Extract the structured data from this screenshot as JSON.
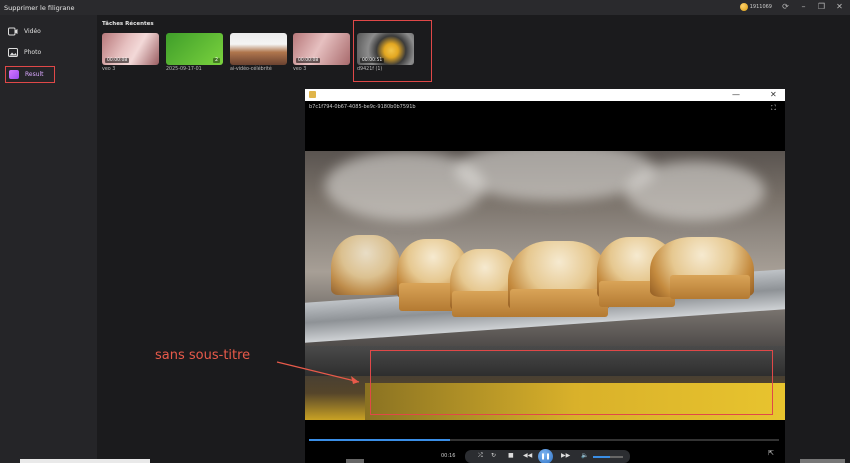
{
  "app": {
    "title": "Supprimer le filigrane"
  },
  "titlebar": {
    "user_id": "1911069",
    "icons": [
      "coin-icon",
      "refresh-icon",
      "minimize-icon",
      "restore-icon",
      "close-icon"
    ]
  },
  "sidebar": {
    "items": [
      {
        "label": "Vidéo",
        "icon": "video-icon"
      },
      {
        "label": "Photo",
        "icon": "photo-icon"
      },
      {
        "label": "Result",
        "icon": "folder-icon",
        "selected": true
      }
    ]
  },
  "recent": {
    "title": "Tâches Récentes",
    "items": [
      {
        "label": "veo 3",
        "duration": "00:00:08",
        "badge": ""
      },
      {
        "label": "2025-09-17-01",
        "duration": "",
        "badge": "2"
      },
      {
        "label": "ai-vidéo-célébrité",
        "duration": "",
        "badge": ""
      },
      {
        "label": "veo 3",
        "duration": "00:00:08",
        "badge": ""
      },
      {
        "label": "d9421f (1)",
        "duration": "00:00:51",
        "badge": ""
      }
    ]
  },
  "player": {
    "filename": "b7c1f794-0b67-4085-be9c-9180b0b7591b",
    "time": "00:16",
    "progress": 0.3,
    "volume": 0.55
  },
  "annotation": {
    "text": "sans sous-titre"
  },
  "colors": {
    "accent": "#e04848",
    "selected": "#b46cf7",
    "progress": "#3a8ee6"
  }
}
